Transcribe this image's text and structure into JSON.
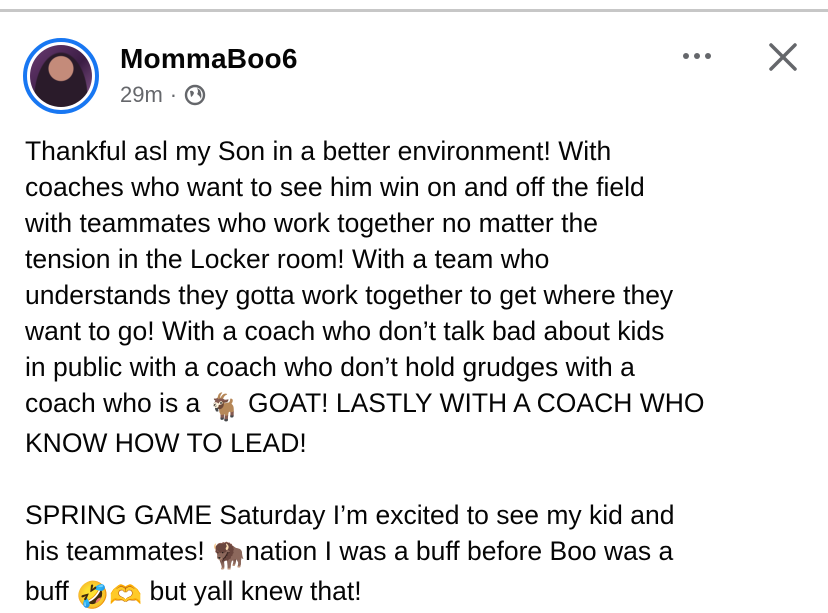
{
  "post": {
    "author": "MommaBoo6",
    "timestamp": "29m",
    "separator": "·",
    "privacy_icon": "globe-icon",
    "menu_icon": "more-options-icon",
    "close_icon": "close-icon",
    "body_part1": "Thankful asl my Son in a better environment! With\ncoaches who want to see him win on and off the field\nwith teammates who work together no matter the\ntension in the Locker room! With a team who\nunderstands they gotta work together to get where they\nwant to go! With a coach who don’t talk bad about kids\nin public with a coach who don’t hold grudges with a\ncoach who is a ",
    "emoji_goat": "🐐",
    "body_part2": " GOAT! LASTLY WITH A COACH WHO\nKNOW HOW TO LEAD!\n\nSPRING GAME Saturday I’m excited to see my kid and\nhis teammates! ",
    "emoji_bison": "🦬",
    "body_part3": "nation I was a buff before Boo was a\nbuff ",
    "emoji_rofl": "🤣",
    "emoji_heart_hands": "🫶",
    "body_part4": " but yall knew that!"
  },
  "colors": {
    "text": "#050505",
    "secondary_text": "#65676b",
    "avatar_ring": "#1877f2",
    "background": "#ffffff"
  }
}
